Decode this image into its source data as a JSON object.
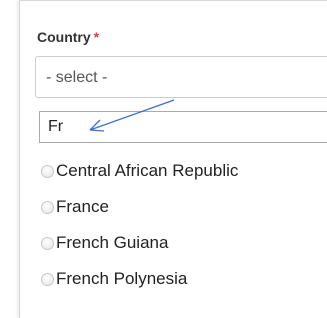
{
  "form": {
    "country_label": "Country",
    "required_mark": "*",
    "select_value": "- select -"
  },
  "dropdown": {
    "search_value": "Fr",
    "options": [
      {
        "label": "Central African Republic"
      },
      {
        "label": "France"
      },
      {
        "label": "French Guiana"
      },
      {
        "label": "French Polynesia"
      }
    ]
  },
  "colors": {
    "required": "#e43d3d",
    "annotation_arrow": "#3a6fd0",
    "border": "#cccccc"
  }
}
